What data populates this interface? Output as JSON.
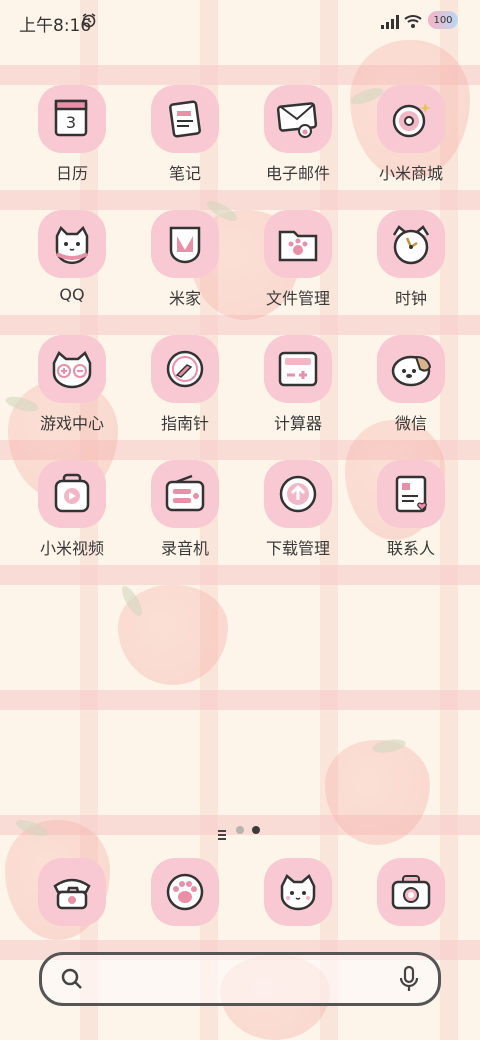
{
  "status_bar": {
    "time": "上午8:16",
    "battery": "100",
    "alarm_icon": "alarm-icon",
    "signal_icon": "signal-icon",
    "wifi_icon": "wifi-icon"
  },
  "apps": [
    {
      "label": "日历",
      "icon": "calendar-icon",
      "glyph": "3"
    },
    {
      "label": "笔记",
      "icon": "notes-icon"
    },
    {
      "label": "电子邮件",
      "icon": "email-icon"
    },
    {
      "label": "小米商城",
      "icon": "donut-icon"
    },
    {
      "label": "QQ",
      "icon": "qq-cat-icon"
    },
    {
      "label": "米家",
      "icon": "mijia-icon"
    },
    {
      "label": "文件管理",
      "icon": "folder-icon"
    },
    {
      "label": "时钟",
      "icon": "clock-icon"
    },
    {
      "label": "游戏中心",
      "icon": "game-cat-icon"
    },
    {
      "label": "指南针",
      "icon": "compass-icon"
    },
    {
      "label": "计算器",
      "icon": "calculator-icon"
    },
    {
      "label": "微信",
      "icon": "wechat-dog-icon"
    },
    {
      "label": "小米视频",
      "icon": "video-icon"
    },
    {
      "label": "录音机",
      "icon": "recorder-icon"
    },
    {
      "label": "下载管理",
      "icon": "download-icon"
    },
    {
      "label": "联系人",
      "icon": "contacts-icon"
    }
  ],
  "dock": [
    {
      "icon": "phone-icon"
    },
    {
      "icon": "paw-icon"
    },
    {
      "icon": "cat-face-icon"
    },
    {
      "icon": "camera-icon"
    }
  ],
  "page_indicator": {
    "pages": 2,
    "active": 2
  },
  "search": {
    "search_icon": "search-icon",
    "mic_icon": "mic-icon"
  },
  "colors": {
    "icon_bg": "#f8c8d3",
    "accent": "#e98fa7",
    "text": "#3a3a3a",
    "background": "#fdf5ea"
  }
}
